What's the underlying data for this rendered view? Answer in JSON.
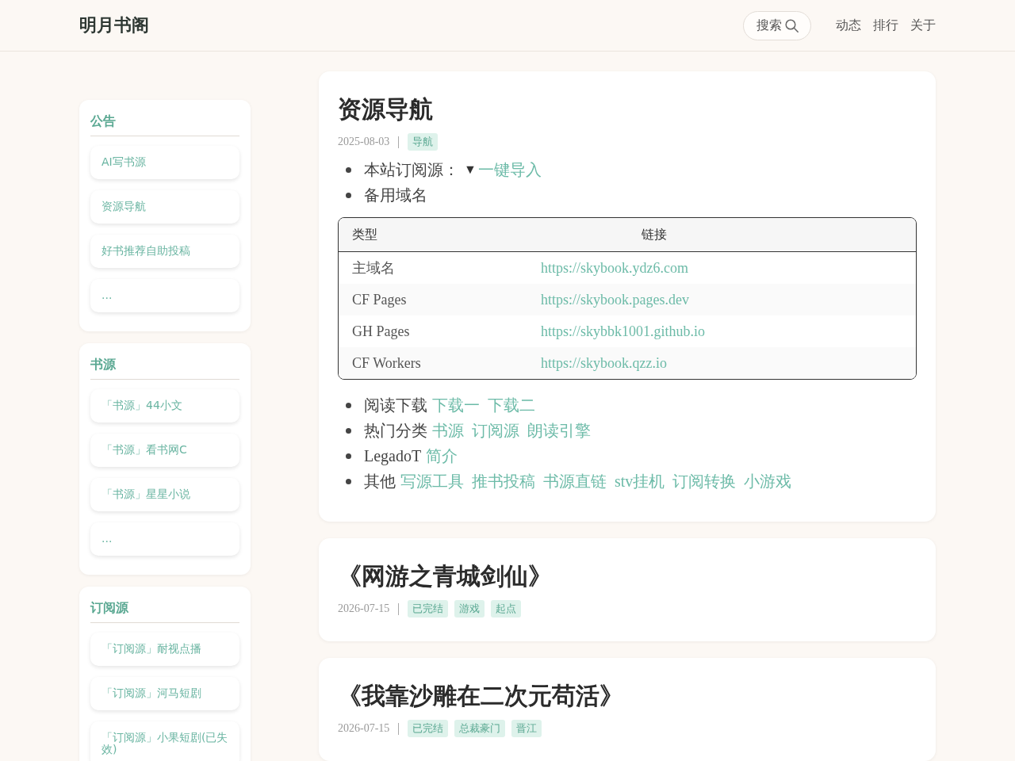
{
  "header": {
    "logo": "明月书阁",
    "search_label": "搜索",
    "nav": [
      "动态",
      "排行",
      "关于"
    ]
  },
  "sidebar": [
    {
      "title": "公告",
      "items": [
        "AI写书源",
        "资源导航",
        "好书推荐自助投稿",
        "..."
      ]
    },
    {
      "title": "书源",
      "items": [
        "「书源」44小文",
        "「书源」看书网C",
        "「书源」星星小说",
        "..."
      ]
    },
    {
      "title": "订阅源",
      "items": [
        "「订阅源」耐视点播",
        "「订阅源」河马短剧",
        "「订阅源」小果短剧(已失效)"
      ]
    }
  ],
  "posts": [
    {
      "title": "资源导航",
      "date": "2025-08-03",
      "tags": [
        "导航"
      ],
      "blocks": [
        {
          "kind": "list",
          "items": [
            {
              "text": "本站订阅源：",
              "marker": "▼",
              "links": [
                "一键导入"
              ]
            },
            {
              "text": "备用域名"
            }
          ]
        },
        {
          "kind": "table",
          "columns": [
            "类型",
            "链接"
          ],
          "rows": [
            [
              "主域名",
              "https://skybook.ydz6.com"
            ],
            [
              "CF Pages",
              "https://skybook.pages.dev"
            ],
            [
              "GH Pages",
              "https://skybbk1001.github.io"
            ],
            [
              "CF Workers",
              "https://skybook.qzz.io"
            ]
          ]
        },
        {
          "kind": "list",
          "items": [
            {
              "text": "阅读下载",
              "links": [
                "下载一",
                "下载二"
              ]
            },
            {
              "text": "热门分类",
              "links": [
                "书源",
                "订阅源",
                "朗读引擎"
              ]
            },
            {
              "text": "LegadoT",
              "links": [
                "简介"
              ]
            },
            {
              "text": "其他",
              "links": [
                "写源工具",
                "推书投稿",
                "书源直链",
                "stv挂机",
                "订阅转换",
                "小游戏"
              ]
            }
          ]
        }
      ]
    },
    {
      "title": "《网游之青城剑仙》",
      "date": "2026-07-15",
      "tags": [
        "已完结",
        "游戏",
        "起点"
      ]
    },
    {
      "title": "《我靠沙雕在二次元苟活》",
      "date": "2026-07-15",
      "tags": [
        "已完结",
        "总裁豪门",
        "晋江"
      ]
    }
  ]
}
